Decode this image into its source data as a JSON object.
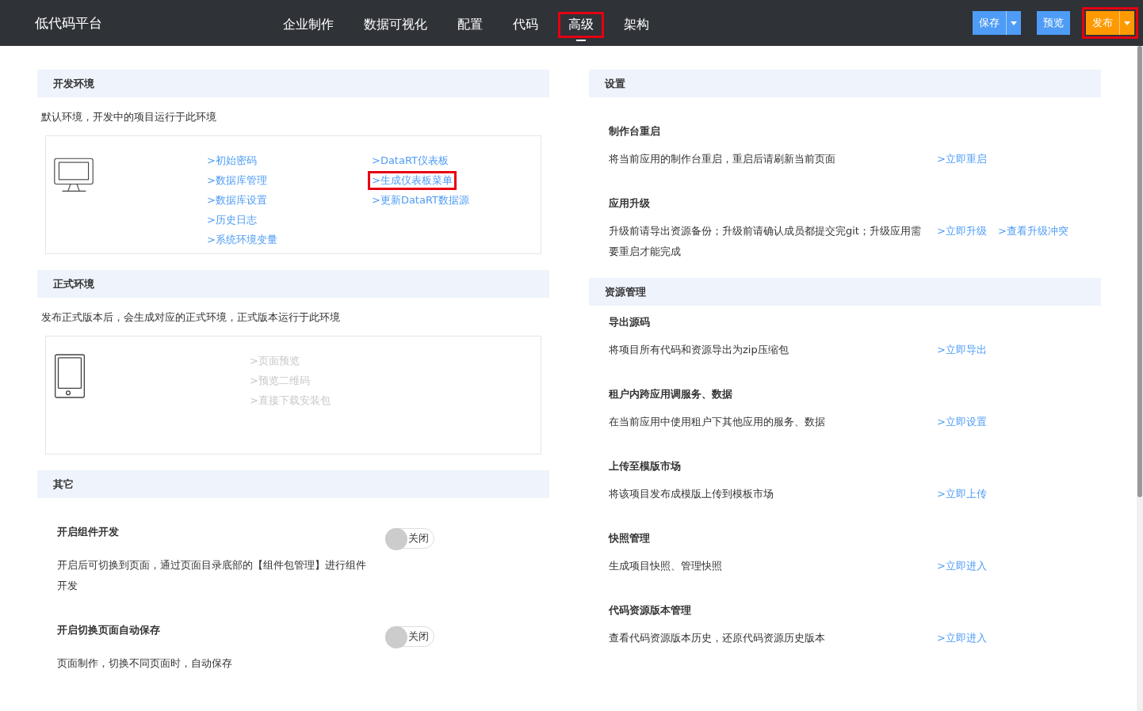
{
  "app_title": "低代码平台",
  "nav": [
    {
      "label": "企业制作",
      "selected": false,
      "highlighted": false
    },
    {
      "label": "数据可视化",
      "selected": false,
      "highlighted": false
    },
    {
      "label": "配置",
      "selected": false,
      "highlighted": false
    },
    {
      "label": "代码",
      "selected": false,
      "highlighted": false
    },
    {
      "label": "高级",
      "selected": true,
      "highlighted": true
    },
    {
      "label": "架构",
      "selected": false,
      "highlighted": false
    }
  ],
  "actions": [
    {
      "label": "保存",
      "kind": "split",
      "color": "#4e9cf5",
      "highlighted": false
    },
    {
      "label": "预览",
      "kind": "plain",
      "color": "#4e9cf5",
      "highlighted": false
    },
    {
      "label": "发布",
      "kind": "split",
      "color": "#ff9900",
      "highlighted": true
    }
  ],
  "left": [
    {
      "kind": "environment",
      "title": "开发环境",
      "description": "默认环境，开发中的项目运行于此环境",
      "device": {
        "kind": "monitor"
      },
      "link_columns": [
        [
          {
            "label": ">初始密码",
            "disabled": false,
            "highlighted": false
          },
          {
            "label": ">数据库管理",
            "disabled": false,
            "highlighted": false
          },
          {
            "label": ">数据库设置",
            "disabled": false,
            "highlighted": false
          },
          {
            "label": ">历史日志",
            "disabled": false,
            "highlighted": false
          },
          {
            "label": ">系统环境变量",
            "disabled": false,
            "highlighted": false
          }
        ],
        [
          {
            "label": ">DataRT仪表板",
            "disabled": false,
            "highlighted": false
          },
          {
            "label": ">生成仪表板菜单",
            "disabled": false,
            "highlighted": true
          },
          {
            "label": ">更新DataRT数据源",
            "disabled": false,
            "highlighted": false
          }
        ]
      ]
    },
    {
      "kind": "environment",
      "title": "正式环境",
      "description": "发布正式版本后，会生成对应的正式环境，正式版本运行于此环境",
      "device": {
        "kind": "tablet"
      },
      "link_columns": [
        [
          {
            "label": ">页面预览",
            "disabled": true,
            "highlighted": false
          },
          {
            "label": ">预览二维码",
            "disabled": true,
            "highlighted": false
          },
          {
            "label": ">直接下载安装包",
            "disabled": true,
            "highlighted": false
          }
        ]
      ]
    },
    {
      "kind": "toggles",
      "title": "其它",
      "toggles": [
        {
          "title": "开启组件开发",
          "description": "开启后可切换到页面，通过页面目录底部的【组件包管理】进行组件开发",
          "on": false,
          "label": "关闭"
        },
        {
          "title": "开启切换页面自动保存",
          "description": "页面制作，切换不同页面时，自动保存",
          "on": false,
          "label": "关闭"
        }
      ]
    }
  ],
  "right": [
    {
      "title": "设置",
      "items": [
        {
          "title": "制作台重启",
          "description": "将当前应用的制作台重启，重启后请刷新当前页面",
          "links": [
            ">立即重启"
          ]
        },
        {
          "title": "应用升级",
          "description": "升级前请导出资源备份；升级前请确认成员都提交完git；升级应用需要重启才能完成",
          "links": [
            ">立即升级",
            ">查看升级冲突"
          ]
        }
      ]
    },
    {
      "title": "资源管理",
      "items": [
        {
          "title": "导出源码",
          "description": "将项目所有代码和资源导出为zip压缩包",
          "links": [
            ">立即导出"
          ]
        },
        {
          "title": "租户内跨应用调服务、数据",
          "description": "在当前应用中使用租户下其他应用的服务、数据",
          "links": [
            ">立即设置"
          ]
        },
        {
          "title": "上传至模版市场",
          "description": "将该项目发布成模版上传到模板市场",
          "links": [
            ">立即上传"
          ]
        },
        {
          "title": "快照管理",
          "description": "生成项目快照、管理快照",
          "links": [
            ">立即进入"
          ]
        },
        {
          "title": "代码资源版本管理",
          "description": "查看代码资源版本历史，还原代码资源历史版本",
          "links": [
            ">立即进入"
          ]
        }
      ]
    }
  ]
}
